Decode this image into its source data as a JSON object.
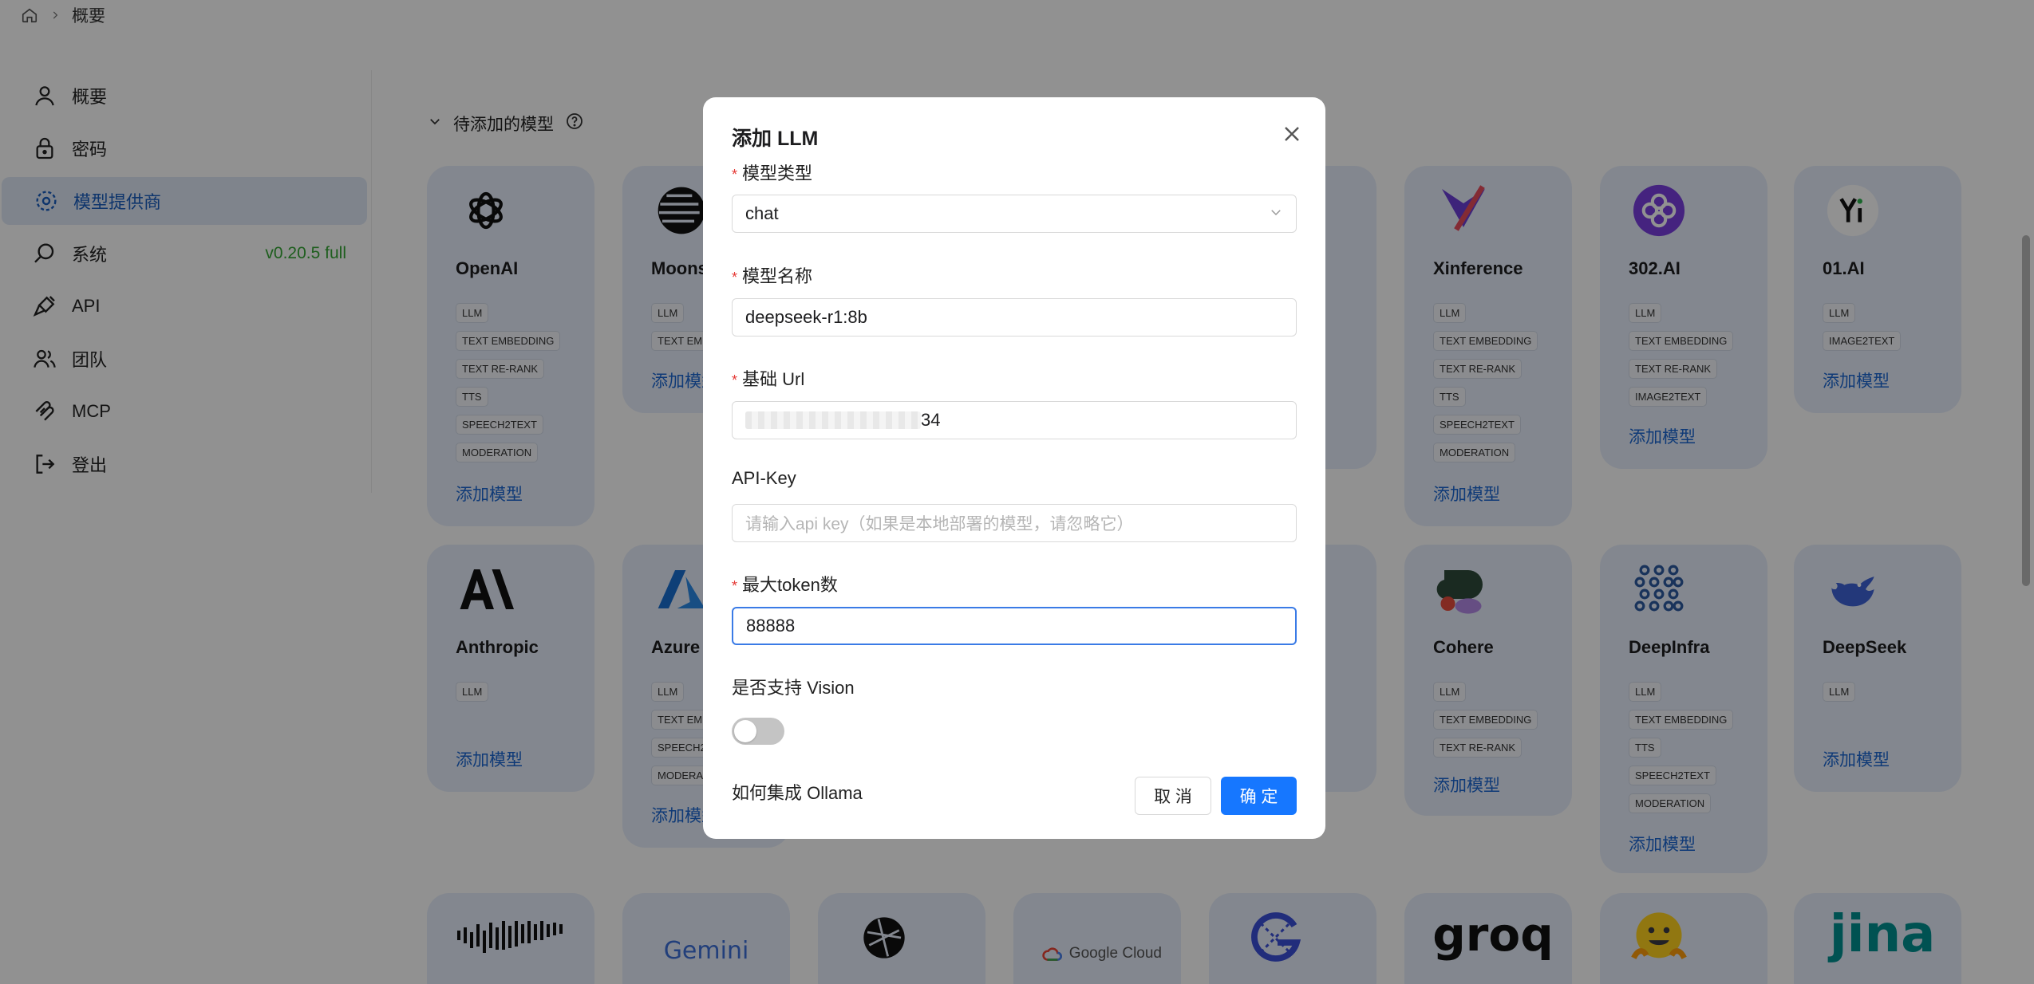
{
  "breadcrumb": {
    "current": "概要"
  },
  "sidebar": {
    "items": [
      {
        "label": "概要",
        "icon": "user-icon"
      },
      {
        "label": "密码",
        "icon": "lock-icon"
      },
      {
        "label": "模型提供商",
        "icon": "model-provider-icon",
        "active": true
      },
      {
        "label": "系统",
        "icon": "system-icon",
        "badge": "v0.20.5 full"
      },
      {
        "label": "API",
        "icon": "api-icon"
      },
      {
        "label": "团队",
        "icon": "team-icon"
      },
      {
        "label": "MCP",
        "icon": "mcp-icon"
      },
      {
        "label": "登出",
        "icon": "logout-icon"
      }
    ]
  },
  "main": {
    "section_title": "待添加的模型",
    "add_label": "添加模型",
    "providers": [
      {
        "name": "OpenAI",
        "tags": [
          "LLM",
          "TEXT EMBEDDING",
          "TEXT RE-RANK",
          "TTS",
          "SPEECH2TEXT",
          "MODERATION"
        ]
      },
      {
        "name": "Moons",
        "tags": [
          "LLM",
          "TEXT EM"
        ]
      },
      {
        "name": "Xinference",
        "tags": [
          "LLM",
          "TEXT EMBEDDING",
          "TEXT RE-RANK",
          "TTS",
          "SPEECH2TEXT",
          "MODERATION"
        ]
      },
      {
        "name": "302.AI",
        "tags": [
          "LLM",
          "TEXT EMBEDDING",
          "TEXT RE-RANK",
          "IMAGE2TEXT"
        ]
      },
      {
        "name": "01.AI",
        "tags": [
          "LLM",
          "IMAGE2TEXT"
        ]
      },
      {
        "name": "Anthropic",
        "tags": [
          "LLM"
        ]
      },
      {
        "name": "Azure",
        "tags": [
          "LLM",
          "TEXT EM",
          "SPEECH2",
          "MODERA"
        ]
      },
      {
        "name": "Cohere",
        "tags": [
          "LLM",
          "TEXT EMBEDDING",
          "TEXT RE-RANK"
        ]
      },
      {
        "name": "DeepInfra",
        "tags": [
          "LLM",
          "TEXT EMBEDDING",
          "TTS",
          "SPEECH2TEXT",
          "MODERATION"
        ]
      },
      {
        "name": "DeepSeek",
        "tags": [
          "LLM"
        ]
      }
    ],
    "bottom_logos": {
      "gemini": "Gemini",
      "google_cloud": "Google Cloud",
      "groq": "groq",
      "jina": "jina"
    }
  },
  "modal": {
    "title": "添加 LLM",
    "fields": {
      "model_type": {
        "label": "模型类型",
        "value": "chat"
      },
      "model_name": {
        "label": "模型名称",
        "value": "deepseek-r1:8b"
      },
      "base_url": {
        "label": "基础 Url",
        "value_suffix": "34"
      },
      "api_key": {
        "label": "API-Key",
        "placeholder": "请输入api key（如果是本地部署的模型，请忽略它）"
      },
      "max_tokens": {
        "label": "最大token数",
        "value": "88888"
      },
      "vision": {
        "label": "是否支持 Vision",
        "enabled": false
      }
    },
    "help_link": "如何集成 Ollama",
    "cancel_label": "取 消",
    "ok_label": "确 定"
  },
  "colors": {
    "accent": "#1677ff",
    "card_bg": "#e6eefb",
    "version_green": "#35a635"
  }
}
